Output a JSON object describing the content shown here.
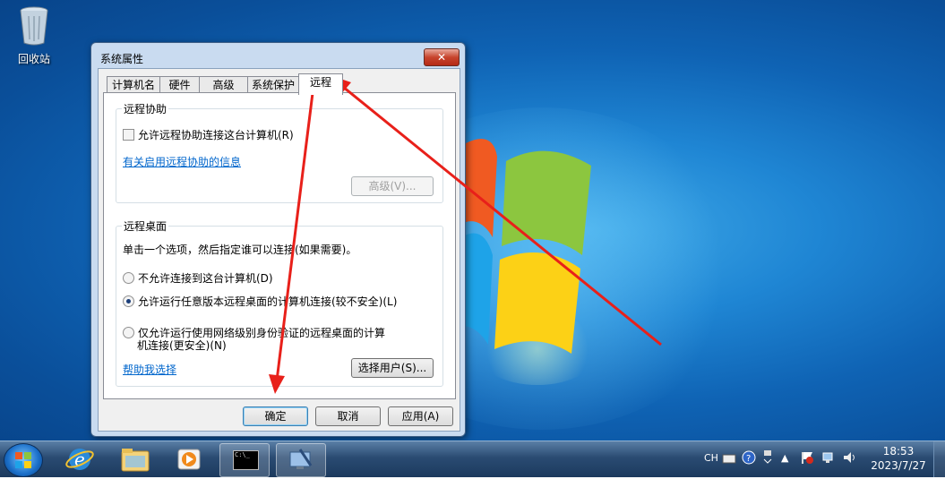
{
  "desktop": {
    "recycle_bin_label": "回收站"
  },
  "dialog": {
    "title": "系统属性",
    "close_glyph": "✕",
    "tabs": [
      "计算机名",
      "硬件",
      "高级",
      "系统保护",
      "远程"
    ],
    "remote_assistance": {
      "group_label": "远程协助",
      "allow_checkbox_label": "允许远程协助连接这台计算机(R)",
      "info_link": "有关启用远程协助的信息",
      "advanced_button": "高级(V)..."
    },
    "remote_desktop": {
      "group_label": "远程桌面",
      "instruction": "单击一个选项，然后指定谁可以连接(如果需要)。",
      "option_deny": "不允许连接到这台计算机(D)",
      "option_any": "允许运行任意版本远程桌面的计算机连接(较不安全)(L)",
      "option_nla_line1": "仅允许运行使用网络级别身份验证的远程桌面的计算",
      "option_nla_line2": "机连接(更安全)(N)",
      "help_link": "帮助我选择",
      "select_users_button": "选择用户(S)..."
    },
    "buttons": {
      "ok": "确定",
      "cancel": "取消",
      "apply": "应用(A)"
    }
  },
  "taskbar": {
    "cmd_icon_text": "C:\\_",
    "tray": {
      "lang": "CH"
    },
    "clock": {
      "time": "18:53",
      "date": "2023/7/27"
    }
  },
  "colors": {
    "annotation_arrow": "#e8201a",
    "link": "#0066cc"
  }
}
